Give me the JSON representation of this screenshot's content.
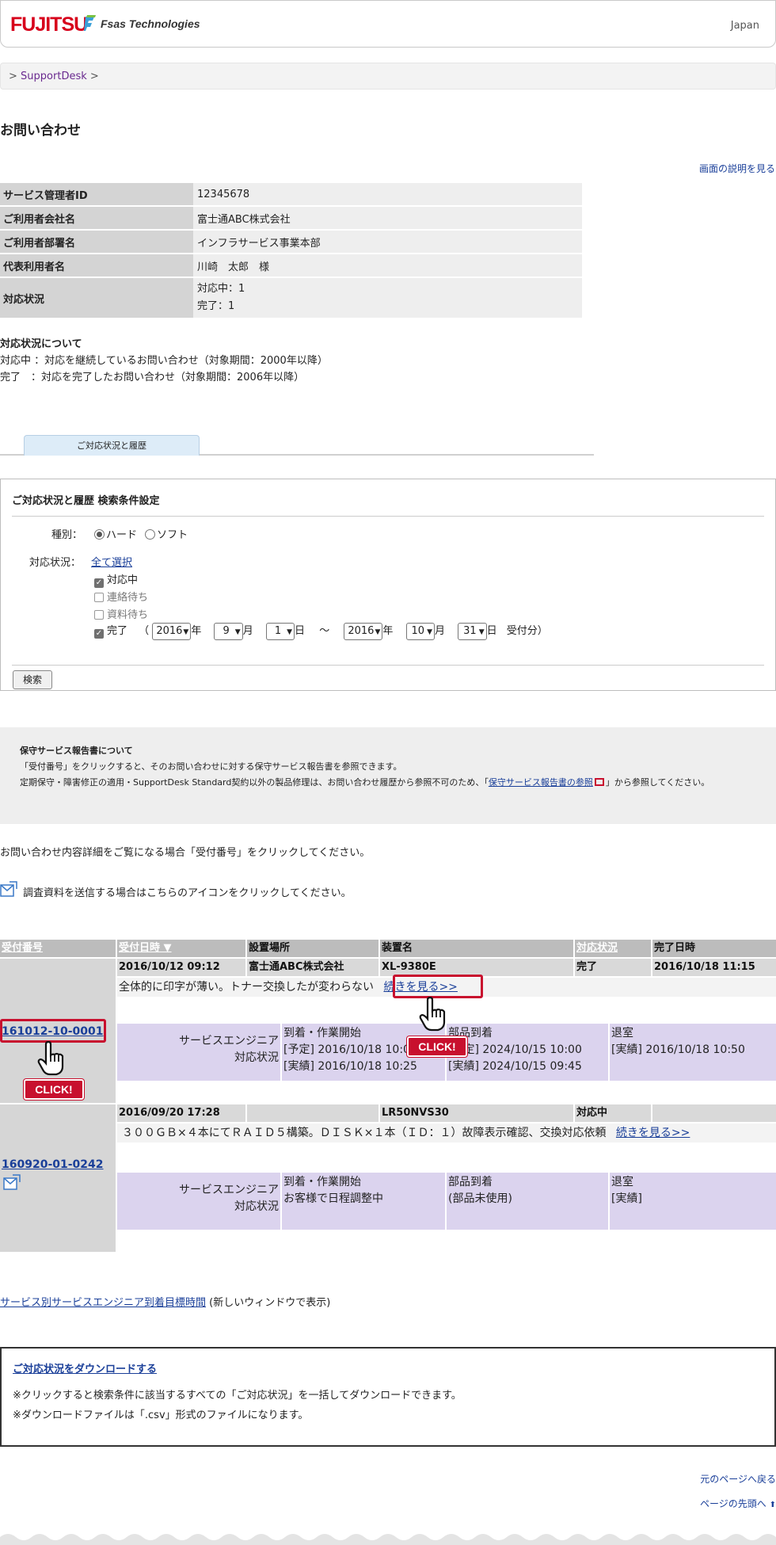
{
  "header": {
    "brand_logo": "FUJITSU",
    "brand_name": "Fsas Technologies",
    "region": "Japan"
  },
  "breadcrumb": {
    "prefix": ">",
    "item": "SupportDesk",
    "suffix": ">"
  },
  "page_title": "お問い合わせ",
  "help_link": "画面の説明を見る",
  "info": {
    "rows": [
      {
        "label": "サービス管理者ID",
        "value": "12345678"
      },
      {
        "label": "ご利用者会社名",
        "value": "富士通ABC株式会社"
      },
      {
        "label": "ご利用者部署名",
        "value": "インフラサービス事業本部"
      },
      {
        "label": "代表利用者名",
        "value": "川崎　太郎　様"
      }
    ],
    "status_label": "対応状況",
    "status_line1": "対応中：1",
    "status_line2": "完了：1"
  },
  "status_note": {
    "heading": "対応状況について",
    "line1": "対応中 ：対応を継続しているお問い合わせ（対象期間：2000年以降）",
    "line2": "完了　：対応を完了したお問い合わせ（対象期間：2006年以降）"
  },
  "tab": {
    "label": "ご対応状況と履歴"
  },
  "search": {
    "title": "ご対応状況と履歴  検索条件設定",
    "type_label": "種別：",
    "type_hard": "ハード",
    "type_soft": "ソフト",
    "type_selected": "ハード",
    "status_label": "対応状況：",
    "select_all": "全て選択",
    "options": [
      {
        "label": "対応中",
        "checked": true
      },
      {
        "label": "連絡待ち",
        "checked": false
      },
      {
        "label": "資料待ち",
        "checked": false
      },
      {
        "label": "完了",
        "checked": true
      }
    ],
    "paren_open": "（",
    "from_year": "2016",
    "from_month": "9",
    "from_day": "1",
    "tilde": "～",
    "to_year": "2016",
    "to_month": "10",
    "to_day": "31",
    "unit_year": "年",
    "unit_month": "月",
    "unit_day": "日",
    "suffix": "受付分）",
    "button": "検索"
  },
  "report_notice": {
    "heading": "保守サービス報告書について",
    "line1": "「受付番号」をクリックすると、そのお問い合わせに対する保守サービス報告書を参照できます。",
    "line2_pre": "定期保守・障害修正の適用・SupportDesk Standard契約以外の製品修理は、お問い合わせ履歴から参照不可のため、「",
    "line2_link": "保守サービス報告書の参照",
    "line2_post": "」から参照してください。"
  },
  "text_detail": "お問い合わせ内容詳細をご覧になる場合「受付番号」をクリックしてください。",
  "text_upload": "調査資料を送信する場合はこちらのアイコンをクリックしてください。",
  "history": {
    "headers": {
      "receipt_no": "受付番号",
      "receipt_date": "受付日時 ▼",
      "location": "設置場所",
      "device": "装置名",
      "status": "対応状況",
      "completed": "完了日時"
    },
    "records": [
      {
        "receipt_no": "161012-10-0001",
        "date": "2016/10/12 09:12",
        "location": "富士通ABC株式会社",
        "device": "XL-9380E",
        "status": "完了",
        "completed": "2016/10/18 11:15",
        "summary": "全体的に印字が薄い。トナー交換したが変わらない",
        "more": "続きを見る>>",
        "eng_label1": "サービスエンジニア",
        "eng_label2": "対応状況",
        "arrival_head": "到着・作業開始",
        "arrival_l1": "[予定] 2016/10/18 10:00",
        "arrival_l2": "[実績] 2016/10/18 10:25",
        "parts_head": "部品到着",
        "parts_l1": "[予定] 2024/10/15 10:00",
        "parts_l2": "[実績] 2024/10/15 09:45",
        "leave_head": "退室",
        "leave_l1": "[実績] 2016/10/18 10:50"
      },
      {
        "receipt_no": "160920-01-0242",
        "date": "2016/09/20 17:28",
        "location": "",
        "device": "LR50NVS30",
        "status": "対応中",
        "completed": "",
        "summary": "３００ＧＢ×４本にてＲＡＩＤ５構築。ＤＩＳＫ×１本（ＩＤ：１）故障表示確認、交換対応依頼",
        "more": "続きを見る>>",
        "eng_label1": "サービスエンジニア",
        "eng_label2": "対応状況",
        "arrival_head": "到着・作業開始",
        "arrival_l1": "お客様で日程調整中",
        "parts_head": "部品到着",
        "parts_l1": "(部品未使用)",
        "leave_head": "退室",
        "leave_l1": "[実績]"
      }
    ]
  },
  "callouts": {
    "click": "CLICK!"
  },
  "target_link": {
    "link": "サービス別サービスエンジニア到着目標時間",
    "note": "(新しいウィンドウで表示)"
  },
  "download": {
    "title": "ご対応状況をダウンロードする",
    "line1": "※クリックすると検索条件に該当するすべての「ご対応状況」を一括してダウンロードできます。",
    "line2": "※ダウンロードファイルは「.csv」形式のファイルになります。"
  },
  "footer": {
    "back": "元のページへ戻る",
    "top": "ページの先頭へ"
  },
  "colors": {
    "brand_red": "#d7001b",
    "link": "#1a3f99",
    "engineer_bg": "#dbd3ee",
    "callout_red": "#c8102e"
  }
}
